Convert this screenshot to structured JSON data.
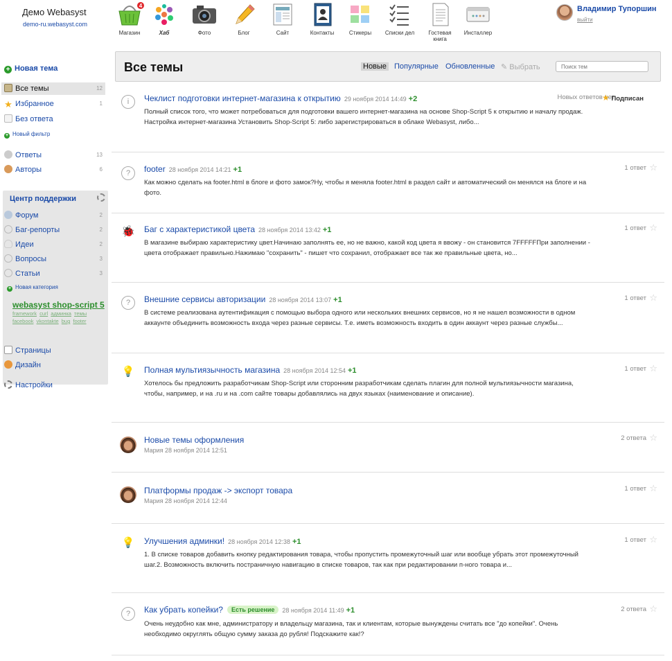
{
  "brand": {
    "title": "Демо Webasyst",
    "subtitle": "demo-ru.webasyst.com"
  },
  "apps": [
    {
      "label": "Магазин",
      "icon": "shop-basket-icon",
      "badge": "4"
    },
    {
      "label": "Хаб",
      "icon": "hub-icon",
      "active": true
    },
    {
      "label": "Фото",
      "icon": "camera-icon"
    },
    {
      "label": "Блог",
      "icon": "pencil-icon"
    },
    {
      "label": "Сайт",
      "icon": "site-icon"
    },
    {
      "label": "Контакты",
      "icon": "contacts-icon"
    },
    {
      "label": "Стикеры",
      "icon": "stickers-icon"
    },
    {
      "label": "Списки дел",
      "icon": "checklist-icon"
    },
    {
      "label": "Гостевая книга",
      "icon": "guestbook-icon"
    },
    {
      "label": "Инсталлер",
      "icon": "installer-icon"
    }
  ],
  "user": {
    "name": "Владимир Тупоршин",
    "logout": "выйти"
  },
  "sidebar": {
    "new_topic": "Новая тема",
    "all_topics": {
      "label": "Все темы",
      "count": "12"
    },
    "favorites": {
      "label": "Избранное",
      "count": "1"
    },
    "unanswered": {
      "label": "Без ответа"
    },
    "new_filter": "Новый фильтр",
    "answers": {
      "label": "Ответы",
      "count": "13"
    },
    "authors": {
      "label": "Авторы",
      "count": "6"
    },
    "support": {
      "title": "Центр поддержки",
      "items": [
        {
          "label": "Форум",
          "count": "2"
        },
        {
          "label": "Баг-репорты",
          "count": "2"
        },
        {
          "label": "Идеи",
          "count": "2"
        },
        {
          "label": "Вопросы",
          "count": "3"
        },
        {
          "label": "Статьи",
          "count": "3"
        }
      ],
      "new_category": "Новая категория",
      "promo_big": [
        "webasyst",
        "shop-script 5"
      ],
      "promo_small": [
        "framework",
        "curl",
        "админка",
        "темы",
        "facebook",
        "vkontakte",
        "bug",
        "footer"
      ]
    },
    "pages": "Страницы",
    "design": "Дизайн",
    "settings": "Настройки"
  },
  "main": {
    "title": "Все темы",
    "filters": {
      "new": "Новые",
      "popular": "Популярные",
      "updated": "Обновленные",
      "select": "Выбрать"
    },
    "search_placeholder": "Поиск тем"
  },
  "topics": [
    {
      "kind": "info",
      "title": "Чеклист подготовки интернет-магазина к открытию",
      "date": "29 ноября 2014 14:49",
      "plus": "+2",
      "text": "Полный список того, что может потребоваться для подготовки вашего интернет-магазина на основе Shop-Script 5 к открытию и началу продаж. Настройка интернет-магазина Установить Shop-Script 5: либо зарегистрироваться в облаке Webasyst, либо...",
      "right": "Новых ответов нет",
      "subscribed": "Подписан",
      "starred": true
    },
    {
      "kind": "question",
      "title": "footer",
      "date": "28 ноября 2014 14:21",
      "plus": "+1",
      "text": "Как можно сделать на footer.html в блоге и фото замок?Ну, чтобы я меняла footer.html в раздел сайт и автоматический он менялся на блоге и на фото.",
      "right": "1 ответ"
    },
    {
      "kind": "bug",
      "title": "Баг с характеристикой цвета",
      "date": "28 ноября 2014 13:42",
      "plus": "+1",
      "text": "В магазине выбираю характеристику цвет.Начинаю заполнять ее, но не важно, какой код цвета я ввожу - он становится 7FFFFFПри заполнении - цвета отображает правильно.Нажимаю \"сохранить\" - пишет что сохранил, отображает все так же правильные цвета, но...",
      "right": "1 ответ"
    },
    {
      "kind": "question",
      "title": "Внешние сервисы авторизации",
      "date": "28 ноября 2014 13:07",
      "plus": "+1",
      "text": "В системе реализована аутентификация с помощью выбора одного или нескольких внешних сервисов, но я не нашел возможности в одном аккаунте объединить возможность входа через разные сервисы. Т.е. иметь возможность входить в один аккаунт через разные службы...",
      "right": "1 ответ"
    },
    {
      "kind": "idea",
      "title": "Полная мультиязычность магазина",
      "date": "28 ноября 2014 12:54",
      "plus": "+1",
      "text": "Хотелось бы предложить разработчикам Shop-Script или сторонним разработчикам сделать плагин для полной мультиязычности магазина, чтобы, например, и на .ru и на .com сайте товары добавлялись на двух языках (наименование и описание).",
      "right": "1 ответ"
    },
    {
      "kind": "avatar",
      "title": "Новые темы оформления",
      "author": "Мария 28 ноября 2014 12:51",
      "right": "2 ответа"
    },
    {
      "kind": "avatar",
      "title": "Платформы продаж -> экспорт товара",
      "author": "Мария 28 ноября 2014 12:44",
      "right": "1 ответ"
    },
    {
      "kind": "idea",
      "title": "Улучшения админки!",
      "date": "28 ноября 2014 12:38",
      "plus": "+1",
      "text": "1. В списке товаров добавить кнопку редактирования товара, чтобы пропустить промежуточный шаг или вообще убрать этот промежуточный шаг.2. Возможность включить постраничную навигацию в списке товаров, так как при редактировании п-ного товара и...",
      "right": "1 ответ"
    },
    {
      "kind": "question",
      "title": "Как убрать копейки?",
      "solution": "Есть решение",
      "date": "28 ноября 2014 11:49",
      "plus": "+1",
      "text": "Очень неудобно как мне, администратору и владельцу магазина, так и клиентам, которые вынуждены считать все \"до копейки\". Очень необходимо округлять общую сумму заказа до рубля! Подскажите как!?",
      "right": "2 ответа"
    }
  ],
  "colors": {
    "link": "#1a4aa8",
    "plus": "#2c8e2c",
    "star": "#f2b01e",
    "badge": "#e0262a"
  }
}
